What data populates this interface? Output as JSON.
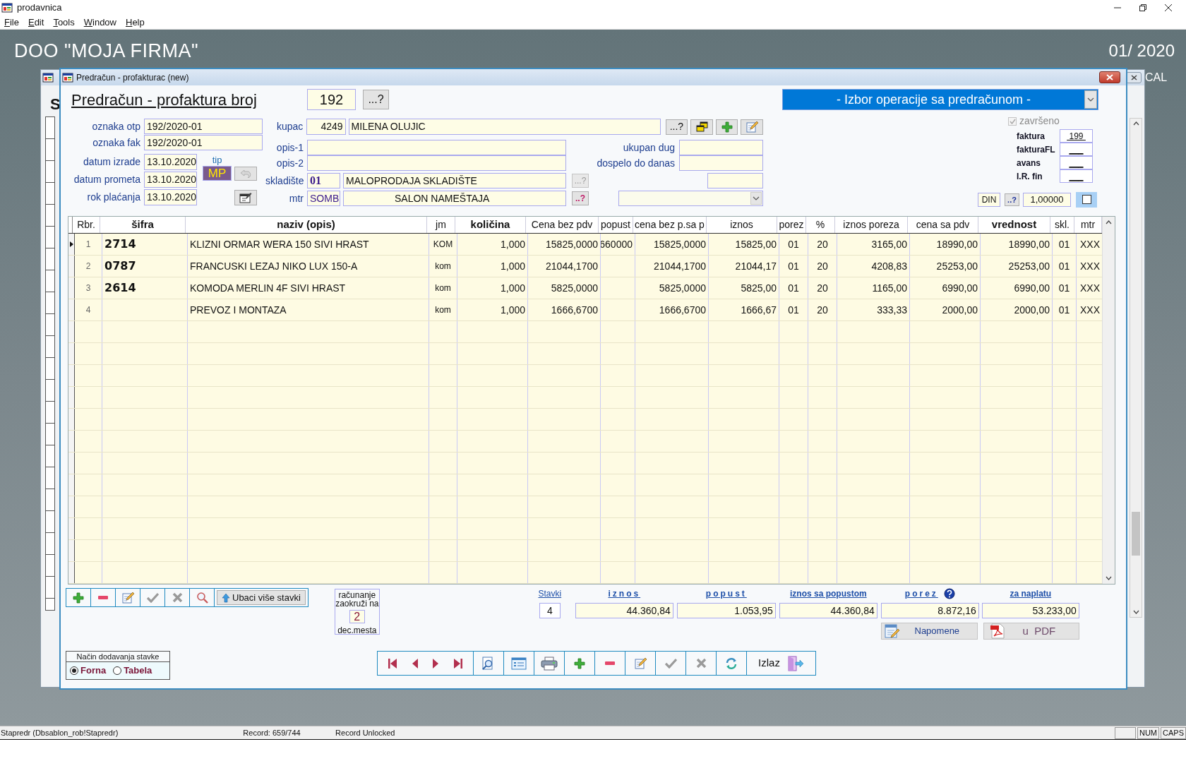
{
  "app": {
    "title": "prodavnica",
    "menu": [
      "File",
      "Edit",
      "Tools",
      "Window",
      "Help"
    ],
    "company": "DOO  \"MOJA FIRMA\"",
    "period": "01/ 2020",
    "side_text": "CAL"
  },
  "background_window": {
    "letter": "S"
  },
  "dialog": {
    "title": "Predračun - profakturac  (new)",
    "heading": "Predračun - profaktura broj",
    "number": "192",
    "number_lookup": "...?",
    "operations": "- Izbor operacije sa predračunom -",
    "left_fields": [
      {
        "label": "oznaka otp",
        "value": "192/2020-01"
      },
      {
        "label": "oznaka fak",
        "value": "192/2020-01"
      }
    ],
    "dates": [
      {
        "label": "datum izrade",
        "value": "13.10.2020"
      },
      {
        "label": "datum prometa",
        "value": "13.10.2020"
      },
      {
        "label": "rok plaćanja",
        "value": "13.10.2020"
      }
    ],
    "tip": {
      "label": "tip",
      "value": "MP"
    },
    "customer": {
      "label": "kupac",
      "code": "4249",
      "name": "MILENA OLUJIC",
      "lookup": "...?"
    },
    "descriptions": [
      {
        "label": "opis-1"
      },
      {
        "label": "opis-2"
      }
    ],
    "debt": [
      {
        "label": "ukupan dug"
      },
      {
        "label": "dospelo do danas"
      }
    ],
    "warehouse": {
      "label": "skladište",
      "code": "01",
      "name": "MALOPRODAJA SKLADIŠTE",
      "lookup": "...?",
      "disabled": true
    },
    "mtr": {
      "label": "mtr",
      "code": "SOMB",
      "name": "SALON NAMEŠTAJA",
      "lookup": "..?",
      "disabled": false
    },
    "completed": {
      "label": "završeno",
      "checked": true
    },
    "links": [
      {
        "label": "faktura",
        "value": " 199 "
      },
      {
        "label": "fakturaFL",
        "value": "___"
      },
      {
        "label": "avans",
        "value": "___"
      },
      {
        "label": "I.R. fin",
        "value": "___"
      }
    ],
    "currency": {
      "code": "DIN",
      "lookup": "..?",
      "rate": "1,00000",
      "checked": false
    },
    "grid": {
      "columns": [
        {
          "label": "Rbr.",
          "bold": false
        },
        {
          "label": "šifra",
          "bold": true
        },
        {
          "label": "naziv (opis)",
          "bold": true
        },
        {
          "label": "jm",
          "bold": false
        },
        {
          "label": "količina",
          "bold": true
        },
        {
          "label": "Cena bez pdv",
          "bold": false
        },
        {
          "label": "popust",
          "bold": false
        },
        {
          "label": "cena bez p.sa p",
          "bold": false
        },
        {
          "label": "iznos",
          "bold": false
        },
        {
          "label": "porez",
          "bold": false
        },
        {
          "label": "%",
          "bold": false
        },
        {
          "label": "iznos poreza",
          "bold": false
        },
        {
          "label": "cena sa pdv",
          "bold": false
        },
        {
          "label": "vrednost",
          "bold": true
        },
        {
          "label": "skl.",
          "bold": false
        },
        {
          "label": "mtr",
          "bold": false
        }
      ],
      "rows": [
        {
          "current": true,
          "cells": [
            "1",
            "2714",
            "KLIZNI ORMAR WERA 150 SIVI HRAST",
            "KOM",
            "1,000",
            "15825,0000",
            "660000",
            "15825,0000",
            "15825,00",
            "01",
            "20",
            "3165,00",
            "18990,00",
            "18990,00",
            "01",
            "XXX"
          ]
        },
        {
          "current": false,
          "cells": [
            "2",
            "0787",
            "FRANCUSKI LEZAJ NIKO LUX 150-A",
            "kom",
            "1,000",
            "21044,1700",
            null,
            "21044,1700",
            "21044,17",
            "01",
            "20",
            "4208,83",
            "25253,00",
            "25253,00",
            "01",
            "XXX"
          ]
        },
        {
          "current": false,
          "cells": [
            "3",
            "2614",
            "KOMODA MERLIN 4F SIVI HRAST",
            "kom",
            "1,000",
            "5825,0000",
            null,
            "5825,0000",
            "5825,00",
            "01",
            "20",
            "1165,00",
            "6990,00",
            "6990,00",
            "01",
            "XXX"
          ]
        },
        {
          "current": false,
          "cells": [
            "4",
            null,
            "PREVOZ I MONTAZA",
            "kom",
            "1,000",
            "1666,6700",
            null,
            "1666,6700",
            "1666,67",
            "01",
            "20",
            "333,33",
            "2000,00",
            "2000,00",
            "01",
            "XXX"
          ]
        }
      ]
    },
    "insert_button": "Ubaci više stavki",
    "rounding": {
      "top": "računanje zaokruži na",
      "value": "2",
      "bottom": "dec.mesta"
    },
    "totals": [
      {
        "label": "Stavki",
        "value": "4",
        "spaced": false
      },
      {
        "label": "iznos",
        "value": "44.360,84",
        "spaced": true
      },
      {
        "label": "popust",
        "value": "1.053,95",
        "spaced": true
      },
      {
        "label": "iznos sa popustom",
        "value": "44.360,84",
        "spaced": false
      },
      {
        "label": "porez",
        "value": "8.872,16",
        "spaced": true
      },
      {
        "label": "za naplatu",
        "value": "53.233,00",
        "spaced": false
      }
    ],
    "notes_button": "Napomene",
    "pdf_button": "u  PDF",
    "add_mode": {
      "title": "Način dodavanja stavke",
      "options": [
        {
          "label": "Forna",
          "selected": true
        },
        {
          "label": "Tabela",
          "selected": false
        }
      ]
    },
    "exit_button": "Izlaz"
  },
  "status_bar": {
    "panes": [
      "Stapredr (Dbsablon_rob!Stapredr)",
      "Record: 659/744",
      "Record Unlocked"
    ],
    "indicators": [
      "NUM",
      "CAPS"
    ]
  }
}
